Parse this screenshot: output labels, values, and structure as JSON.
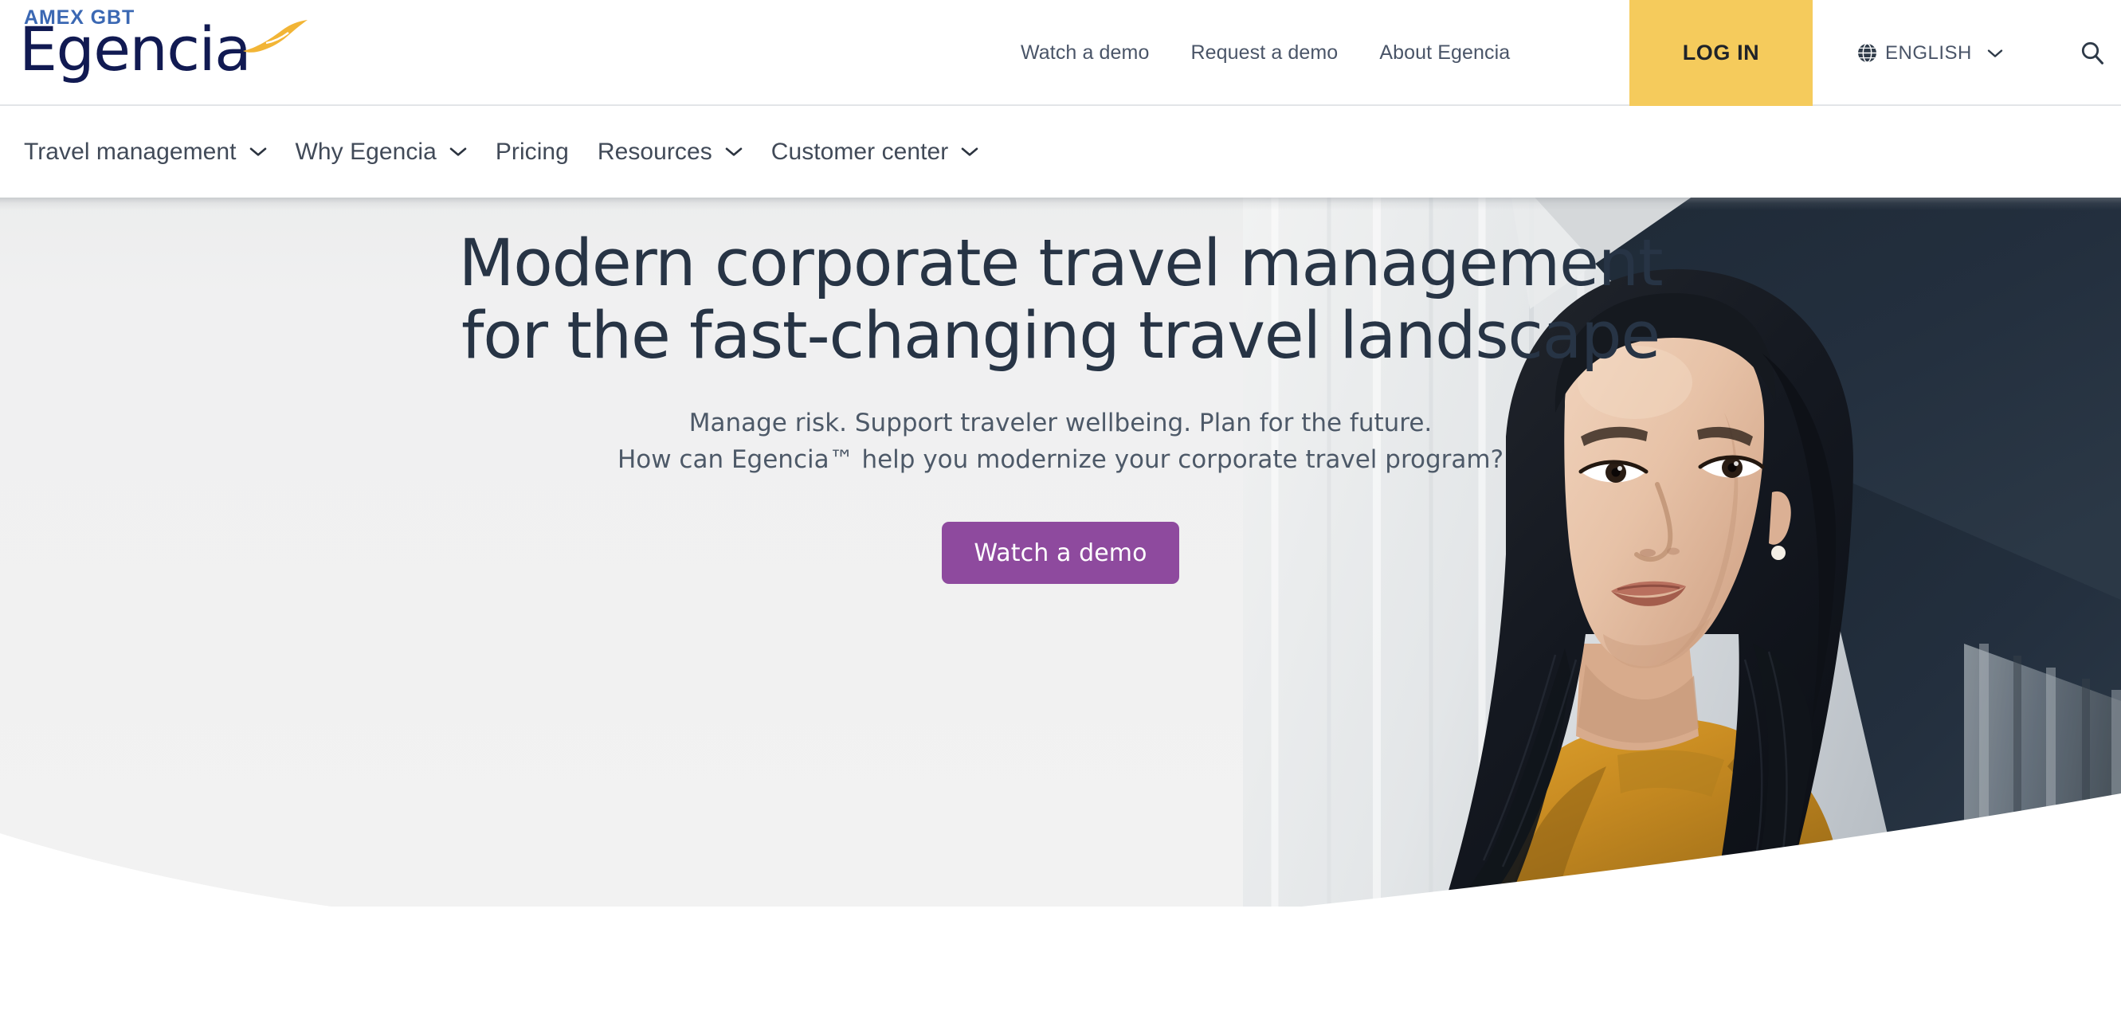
{
  "brand": {
    "parent_name": "AMEX GBT",
    "name": "Egencia",
    "swoosh_color": "#f2b536",
    "wordmark_color": "#111a52",
    "parent_color": "#3b68b3"
  },
  "header": {
    "nav_links": [
      {
        "label": "Watch a demo"
      },
      {
        "label": "Request a demo"
      },
      {
        "label": "About Egencia"
      }
    ],
    "login_label": "LOG IN",
    "login_bg": "#f5cb5c",
    "language": {
      "label": "ENGLISH",
      "icon": "globe-icon",
      "chevron": "chevron-down-icon"
    },
    "search": {
      "icon": "search-icon",
      "label": "Search"
    }
  },
  "sub_nav": {
    "items": [
      {
        "label": "Travel management",
        "has_dropdown": true
      },
      {
        "label": "Why Egencia",
        "has_dropdown": true
      },
      {
        "label": "Pricing",
        "has_dropdown": false
      },
      {
        "label": "Resources",
        "has_dropdown": true
      },
      {
        "label": "Customer center",
        "has_dropdown": true
      }
    ]
  },
  "hero": {
    "title_line1": "Modern corporate travel management",
    "title_line2": "for the fast-changing travel landscape",
    "subtitle_line1": "Manage risk. Support traveler wellbeing. Plan for the future.",
    "subtitle_line2": "How can Egencia™ help you modernize your corporate travel program?",
    "cta_label": "Watch a demo",
    "cta_color": "#8e4a9e",
    "background_color": "#f1f1f1",
    "title_color": "#273445",
    "photo_alt": "Woman in mustard top looking upward in front of a modern building",
    "photo_dark_color": "#232f3e"
  }
}
